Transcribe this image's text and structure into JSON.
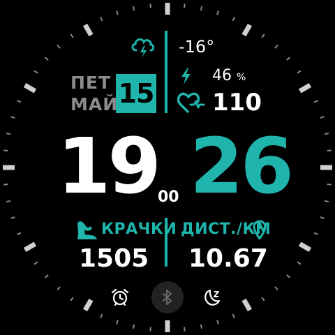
{
  "date": {
    "weekday": "ПЕТ",
    "month": "МАЙ",
    "day": "15"
  },
  "weather": {
    "icon": "cloud-lightning-icon",
    "temperature": "-16°"
  },
  "battery": {
    "icon": "lightning-bolt-icon",
    "value": "46",
    "unit": "%"
  },
  "heart_rate": {
    "icon": "heart-rate-icon",
    "value": "110"
  },
  "time": {
    "hour": "19",
    "minute": "26",
    "seconds": "00"
  },
  "steps": {
    "icon": "steps-icon",
    "label": "КРАЧКИ",
    "value": "1505"
  },
  "distance": {
    "icon": "location-pin-icon",
    "label": "ДИСТ./КМ",
    "value": "10.67"
  },
  "bottom_icons": [
    "alarm-clock-icon",
    "bluetooth-icon",
    "sleep-moon-icon"
  ],
  "colors": {
    "accent": "#1fb5ac",
    "text": "#ffffff",
    "muted": "#8c8c8c",
    "background": "#000000"
  }
}
